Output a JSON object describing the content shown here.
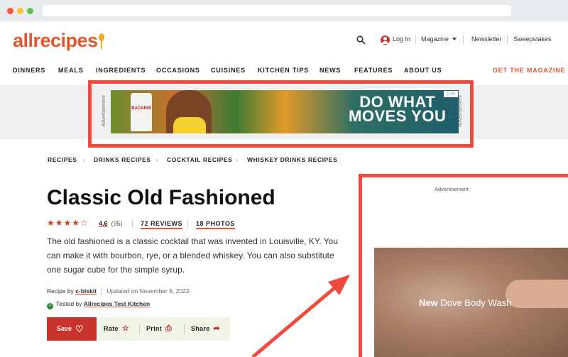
{
  "site": {
    "logo_text": "allrecipes",
    "login": "Log In",
    "magazine": "Magazine",
    "newsletter": "Newsletter",
    "sweepstakes": "Sweepstakes"
  },
  "nav": {
    "items": [
      "DINNERS",
      "MEALS",
      "INGREDIENTS",
      "OCCASIONS",
      "CUISINES",
      "KITCHEN TIPS",
      "NEWS",
      "FEATURES",
      "ABOUT US"
    ],
    "cta": "GET THE MAGAZINE"
  },
  "top_ad": {
    "label": "Advertisement",
    "brand": "BACARDÍ",
    "headline_1": "DO WHAT",
    "headline_2": "MOVES YOU",
    "close": "▷X"
  },
  "breadcrumbs": [
    "RECIPES",
    "DRINKS RECIPES",
    "COCKTAIL RECIPES",
    "WHISKEY DRINKS RECIPES"
  ],
  "recipe": {
    "title": "Classic Old Fashioned",
    "rating_value": "4.6",
    "rating_count": "(95)",
    "rating_stars": 4.5,
    "reviews": "72 REVIEWS",
    "photos": "18 PHOTOS",
    "description": "The old fashioned is a classic cocktail that was invented in Louisville, KY. You can make it with bourbon, rye, or a blended whiskey. You can also substitute one sugar cube for the simple syrup.",
    "recipe_by_prefix": "Recipe by",
    "author": "c-biskit",
    "updated": "Updated on November 8, 2022",
    "tested_prefix": "Tested by",
    "tested_by": "Allrecipes Test Kitchen"
  },
  "actions": {
    "save": "Save",
    "rate": "Rate",
    "print": "Print",
    "share": "Share"
  },
  "side_ad": {
    "label": "Advertisement",
    "text_bold": "New",
    "text_rest": " Dove Body Wash"
  },
  "colors": {
    "brand": "#e4572e",
    "highlight_border": "#f04a3e",
    "save_button": "#c8332b"
  }
}
